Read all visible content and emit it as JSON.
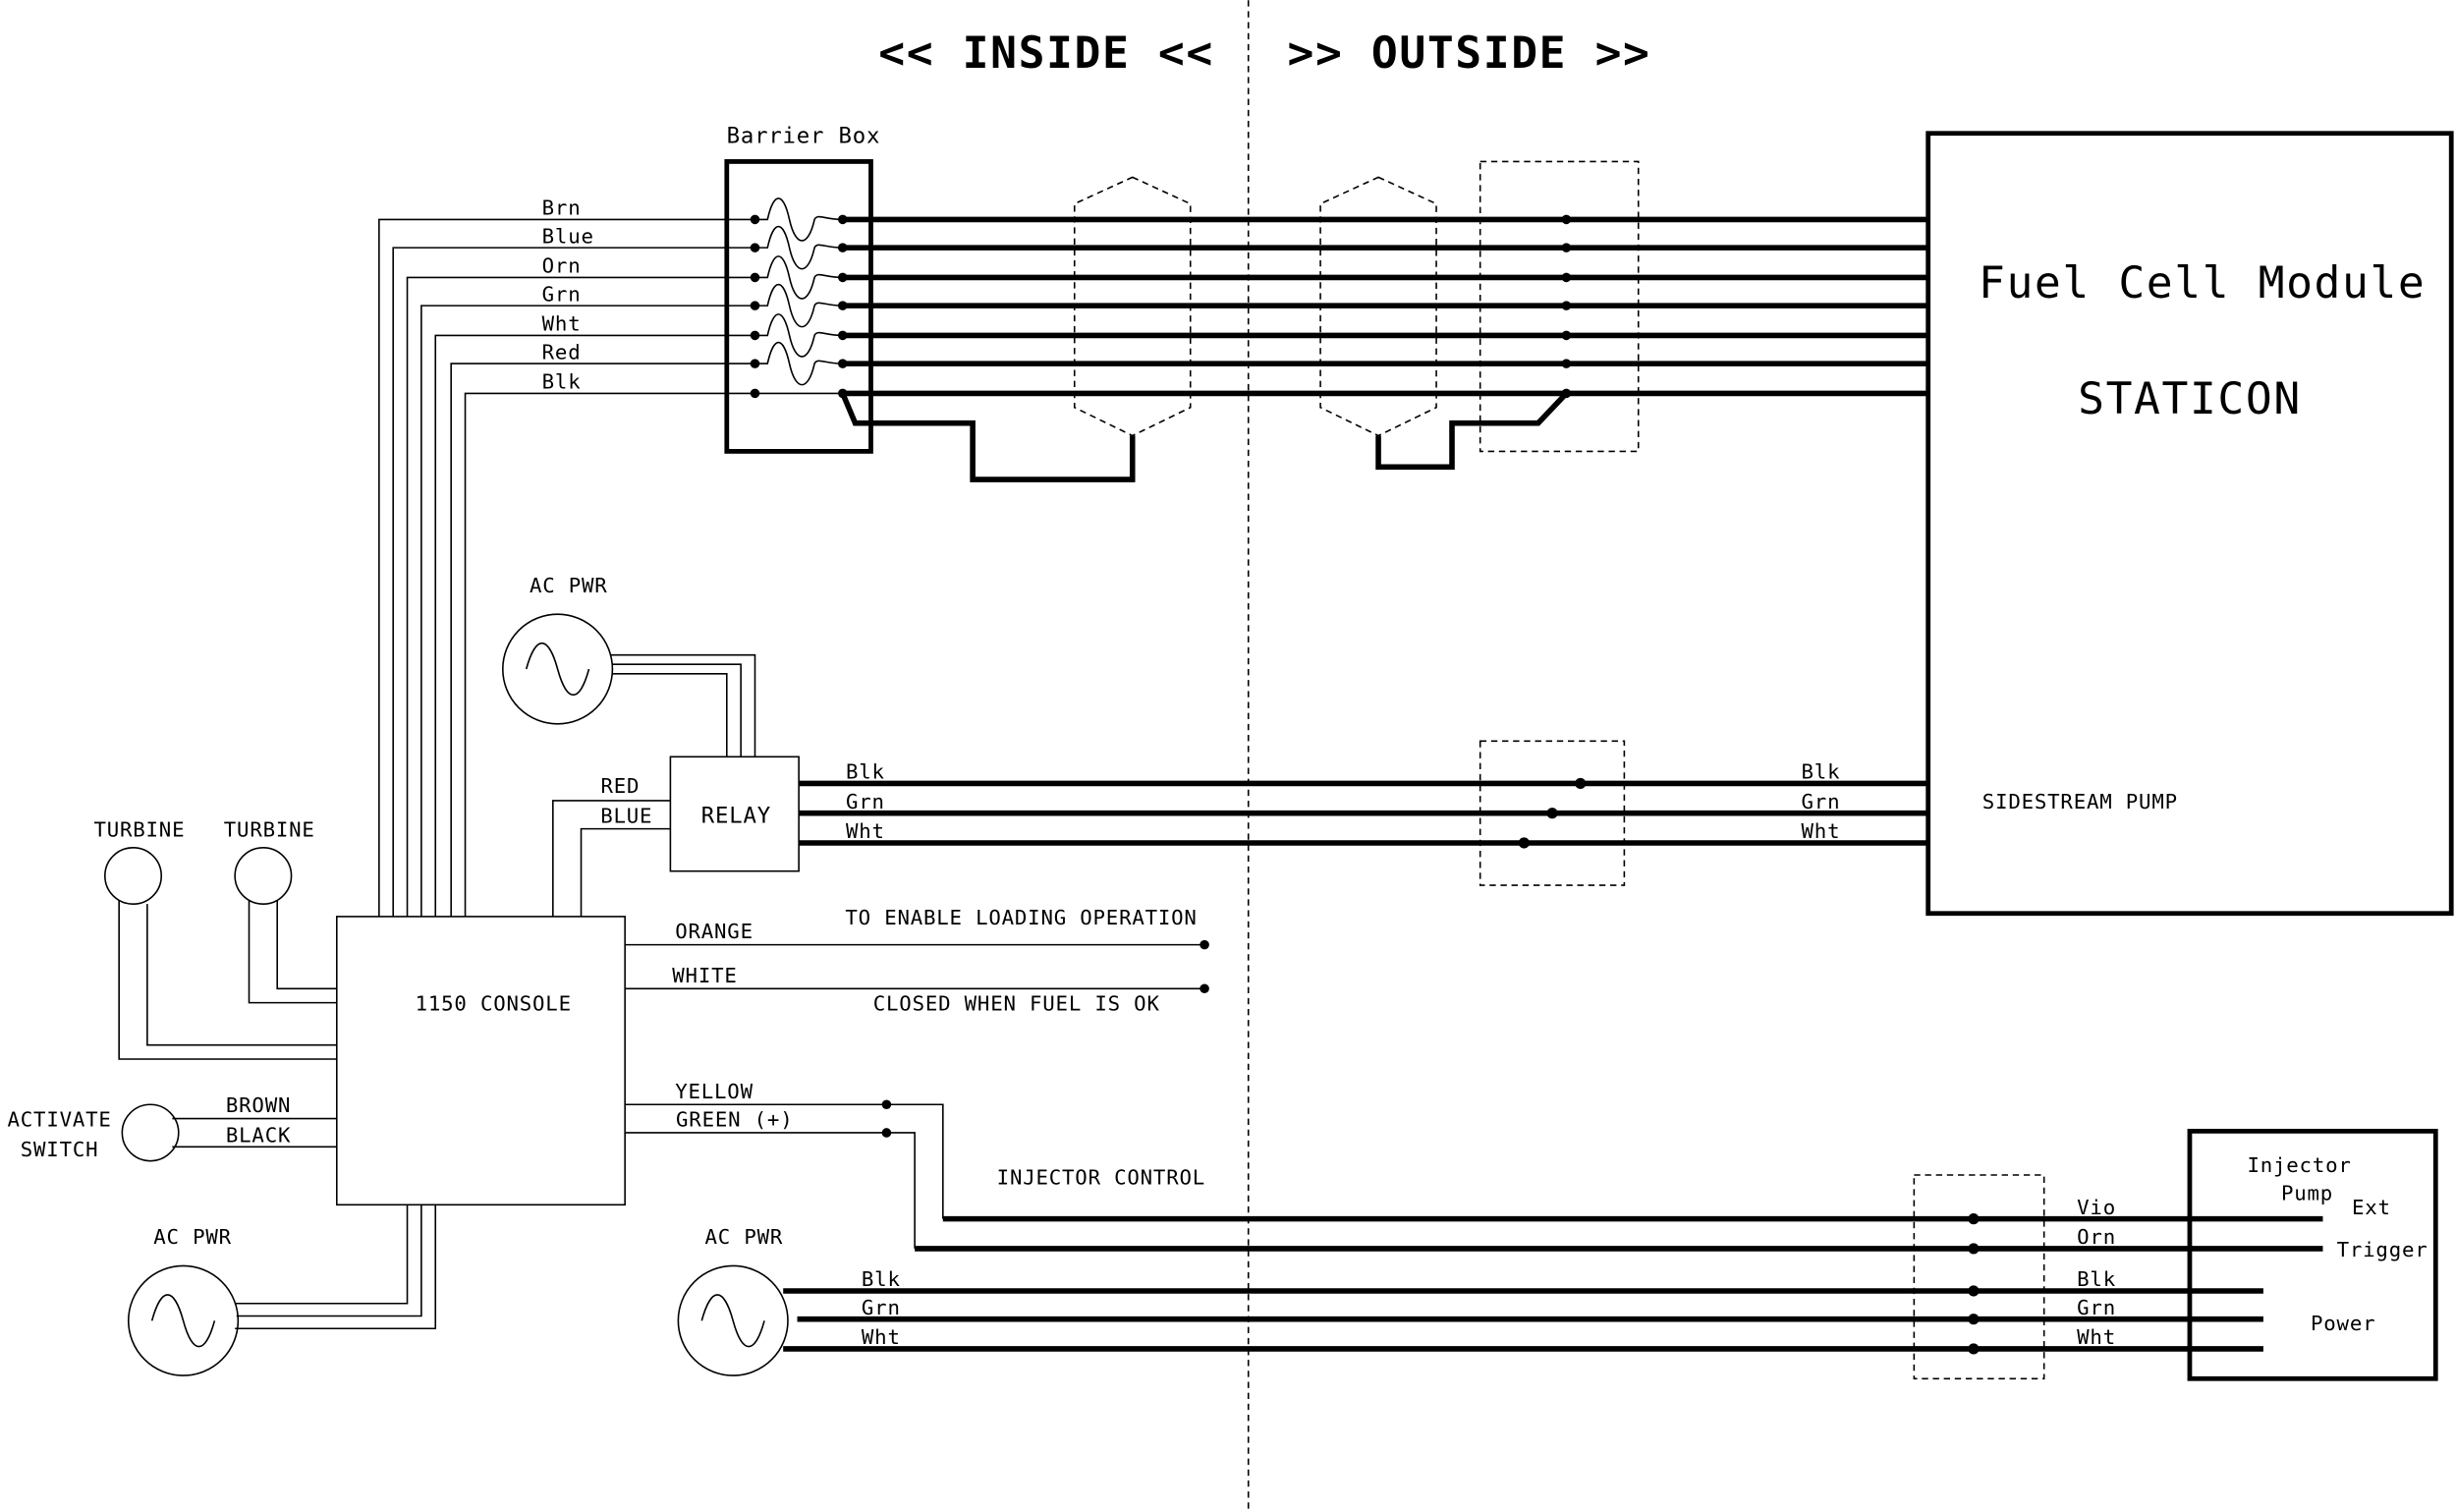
{
  "header": {
    "inside": "<< INSIDE <<",
    "outside": ">> OUTSIDE >>"
  },
  "barrier_box": {
    "label": "Barrier Box",
    "wires": [
      "Brn",
      "Blue",
      "Orn",
      "Grn",
      "Wht",
      "Red",
      "Blk"
    ]
  },
  "fuel_cell": {
    "title": "Fuel Cell Module",
    "subtitle": "STATICON",
    "pump": "SIDESTREAM PUMP"
  },
  "relay": {
    "label": "RELAY",
    "in_red": "RED",
    "in_blue": "BLUE",
    "out_wires": [
      "Blk",
      "Grn",
      "Wht"
    ],
    "ac_label": "AC PWR"
  },
  "console": {
    "label": "1150 CONSOLE",
    "orange": "ORANGE",
    "white": "WHITE",
    "enable_note": "TO ENABLE LOADING OPERATION",
    "closed_note": "CLOSED WHEN FUEL IS OK",
    "yellow": "YELLOW",
    "green": "GREEN (+)",
    "injector_control": "INJECTOR CONTROL"
  },
  "turbines": [
    "TURBINE",
    "TURBINE"
  ],
  "activate_switch": {
    "line1": "ACTIVATE",
    "line2": "SWITCH",
    "brown": "BROWN",
    "black": "BLACK"
  },
  "ac_pwr_console": "AC PWR",
  "ac_pwr_injector": {
    "label": "AC PWR",
    "wires": [
      "Blk",
      "Grn",
      "Wht"
    ]
  },
  "injector_pump": {
    "line1": "Injector",
    "line2": "Pump",
    "ext": "Ext",
    "trigger": "Trigger",
    "power": "Power",
    "wires": [
      "Vio",
      "Orn",
      "Blk",
      "Grn",
      "Wht"
    ]
  }
}
